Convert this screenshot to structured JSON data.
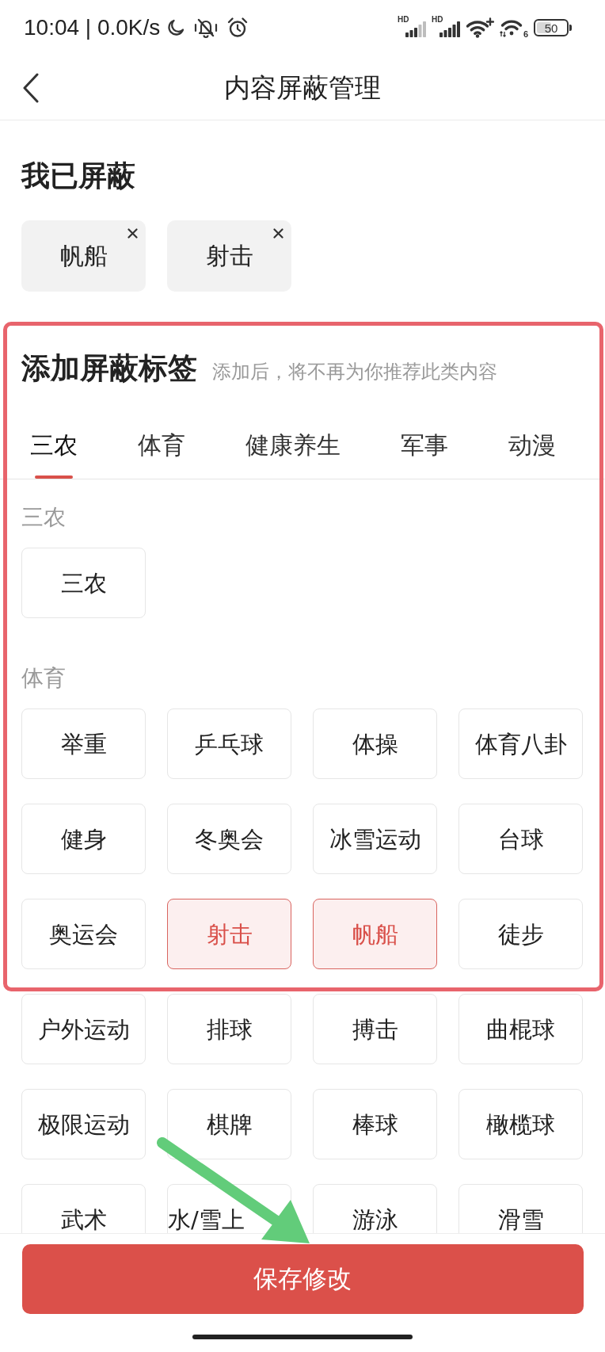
{
  "status_bar": {
    "time": "10:04 | 0.0K/s",
    "signals": [
      {
        "label": "HD"
      },
      {
        "label": "HD"
      }
    ],
    "wifi_badge": "6",
    "battery": "50"
  },
  "header": {
    "title": "内容屏蔽管理"
  },
  "blocked": {
    "title": "我已屏蔽",
    "tags": [
      "帆船",
      "射击"
    ]
  },
  "add_tags": {
    "title": "添加屏蔽标签",
    "subtitle": "添加后，将不再为你推荐此类内容",
    "tabs": [
      {
        "label": "三农",
        "selected": true
      },
      {
        "label": "体育",
        "selected": false
      },
      {
        "label": "健康养生",
        "selected": false
      },
      {
        "label": "军事",
        "selected": false
      },
      {
        "label": "动漫",
        "selected": false
      }
    ],
    "groups": [
      {
        "title": "三农",
        "items": [
          {
            "label": "三农",
            "kind": "tag",
            "selected": false
          }
        ]
      },
      {
        "title": "体育",
        "items": [
          {
            "label": "举重",
            "kind": "tag",
            "selected": false
          },
          {
            "label": "乒乓球",
            "kind": "tag",
            "selected": false
          },
          {
            "label": "体操",
            "kind": "tag",
            "selected": false
          },
          {
            "label": "体育八卦",
            "kind": "tag",
            "selected": false
          },
          {
            "label": "健身",
            "kind": "tag",
            "selected": false
          },
          {
            "label": "冬奥会",
            "kind": "tag",
            "selected": false
          },
          {
            "label": "冰雪运动",
            "kind": "tag",
            "selected": false
          },
          {
            "label": "台球",
            "kind": "tag",
            "selected": false
          },
          {
            "label": "奥运会",
            "kind": "tag",
            "selected": false
          },
          {
            "label": "射击",
            "kind": "tag",
            "selected": true
          },
          {
            "label": "帆船",
            "kind": "tag",
            "selected": true
          },
          {
            "label": "徒步",
            "kind": "tag",
            "selected": false
          },
          {
            "label": "户外运动",
            "kind": "tag",
            "selected": false
          },
          {
            "label": "排球",
            "kind": "tag",
            "selected": false
          },
          {
            "label": "搏击",
            "kind": "tag",
            "selected": false
          },
          {
            "label": "曲棍球",
            "kind": "tag",
            "selected": false
          },
          {
            "label": "极限运动",
            "kind": "tag",
            "selected": false
          },
          {
            "label": "棋牌",
            "kind": "tag",
            "selected": false
          },
          {
            "label": "棒球",
            "kind": "tag",
            "selected": false
          },
          {
            "label": "橄榄球",
            "kind": "tag",
            "selected": false
          },
          {
            "label": "武术",
            "kind": "tag",
            "selected": false
          },
          {
            "label": "水/雪上",
            "kind": "overflow",
            "selected": false
          },
          {
            "label": "游泳",
            "kind": "tag",
            "selected": false
          },
          {
            "label": "滑雪",
            "kind": "tag",
            "selected": false
          }
        ]
      }
    ]
  },
  "save_button": "保存修改"
}
